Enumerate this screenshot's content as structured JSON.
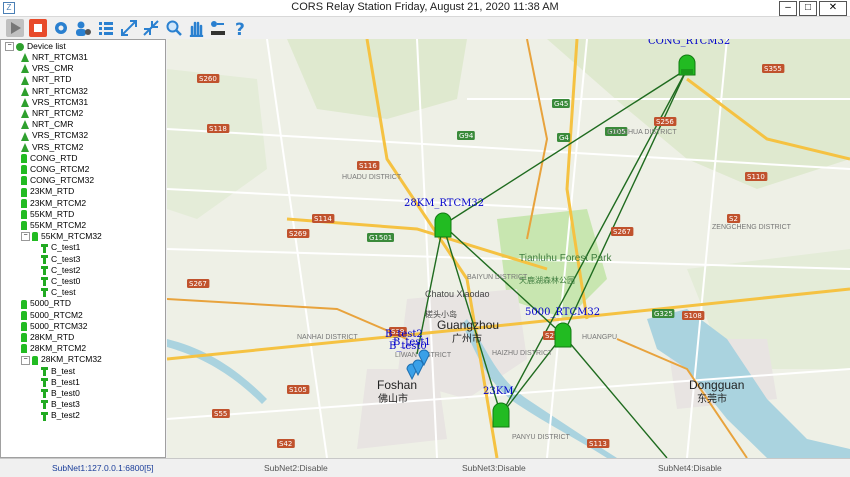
{
  "window": {
    "title": "CORS Relay Station  Friday, August 21, 2020 11:38 AM",
    "min_label": "–",
    "max_label": "□",
    "close_label": "✕"
  },
  "toolbar": {
    "icons": [
      "play-icon",
      "stop-icon",
      "settings-icon",
      "user-settings-icon",
      "list-icon",
      "expand-icon",
      "collapse-icon",
      "zoom-icon",
      "pan-hand-icon",
      "measure-icon",
      "help-icon"
    ]
  },
  "tree": {
    "root": "Device list",
    "items": [
      {
        "label": "NRT_RTCM31",
        "type": "base"
      },
      {
        "label": "VRS_CMR",
        "type": "base"
      },
      {
        "label": "NRT_RTD",
        "type": "base"
      },
      {
        "label": "NRT_RTCM32",
        "type": "base"
      },
      {
        "label": "VRS_RTCM31",
        "type": "base"
      },
      {
        "label": "NRT_RTCM2",
        "type": "base"
      },
      {
        "label": "NRT_CMR",
        "type": "base"
      },
      {
        "label": "VRS_RTCM32",
        "type": "base"
      },
      {
        "label": "VRS_RTCM2",
        "type": "base"
      },
      {
        "label": "CONG_RTD",
        "type": "rover"
      },
      {
        "label": "CONG_RTCM2",
        "type": "rover"
      },
      {
        "label": "CONG_RTCM32",
        "type": "rover"
      },
      {
        "label": "23KM_RTD",
        "type": "rover"
      },
      {
        "label": "23KM_RTCM2",
        "type": "rover"
      },
      {
        "label": "55KM_RTD",
        "type": "rover"
      },
      {
        "label": "55KM_RTCM2",
        "type": "rover"
      },
      {
        "label": "55KM_RTCM32",
        "type": "rover",
        "expanded": true
      },
      {
        "label": "C_test1",
        "type": "child"
      },
      {
        "label": "C_test3",
        "type": "child"
      },
      {
        "label": "C_test2",
        "type": "child"
      },
      {
        "label": "C_test0",
        "type": "child"
      },
      {
        "label": "C_test",
        "type": "child"
      },
      {
        "label": "5000_RTD",
        "type": "rover"
      },
      {
        "label": "5000_RTCM2",
        "type": "rover"
      },
      {
        "label": "5000_RTCM32",
        "type": "rover"
      },
      {
        "label": "28KM_RTD",
        "type": "rover"
      },
      {
        "label": "28KM_RTCM2",
        "type": "rover"
      },
      {
        "label": "28KM_RTCM32",
        "type": "rover",
        "expanded": true
      },
      {
        "label": "B_test",
        "type": "child"
      },
      {
        "label": "B_test1",
        "type": "child"
      },
      {
        "label": "B_test0",
        "type": "child"
      },
      {
        "label": "B_test3",
        "type": "child"
      },
      {
        "label": "B_test2",
        "type": "child"
      }
    ]
  },
  "map": {
    "stations": [
      {
        "label": "CONG_RTCM32"
      },
      {
        "label": "28KM_RTCM32"
      },
      {
        "label": "5000_RTCM32"
      },
      {
        "label": "23KM"
      }
    ],
    "client_labels": [
      "B_test2",
      "B_test1",
      "B_test0"
    ],
    "cities": [
      {
        "en": "Guangzhou",
        "zh": "广州市"
      },
      {
        "en": "Foshan",
        "zh": "佛山市"
      },
      {
        "en": "Dongguan",
        "zh": "东莞市"
      },
      {
        "en": "Chatou Xiaodao",
        "zh": "槎头小岛"
      },
      {
        "en": "Tianluhu Forest Park",
        "zh": "天鹿湖森林公园"
      },
      {
        "en": "HUADU DISTRICT",
        "zh": ""
      },
      {
        "en": "CONGHUA DISTRICT",
        "zh": ""
      },
      {
        "en": "ZENGCHENG DISTRICT",
        "zh": ""
      },
      {
        "en": "HUANGPU",
        "zh": ""
      },
      {
        "en": "PANYU DISTRICT",
        "zh": ""
      },
      {
        "en": "HAIZHU DISTRICT",
        "zh": ""
      },
      {
        "en": "BAIYUN DISTRICT",
        "zh": ""
      },
      {
        "en": "NANHAI DISTRICT",
        "zh": ""
      },
      {
        "en": "LIWAN DISTRICT",
        "zh": ""
      }
    ],
    "road_labels": [
      "S355",
      "S260",
      "S118",
      "G45",
      "G105",
      "G94",
      "S256",
      "S269",
      "S114",
      "S116",
      "S267",
      "S110",
      "G1501",
      "S39",
      "S296",
      "S108",
      "S113",
      "S105",
      "S42",
      "S55",
      "S2",
      "G325",
      "G4",
      "S267"
    ]
  },
  "status": {
    "subnet1": "SubNet1:127.0.0.1:6800[5]",
    "subnet2": "SubNet2:Disable",
    "subnet3": "SubNet3:Disable",
    "subnet4": "SubNet4:Disable"
  },
  "colors": {
    "link_line": "#1f6b1f",
    "station": "#22bb22",
    "client_pin": "#3aa0e8",
    "road": "#ffffff",
    "highway": "#f5c242",
    "park": "#c8e6b0",
    "water": "#aad3df",
    "label_blue": "#0000cc"
  }
}
